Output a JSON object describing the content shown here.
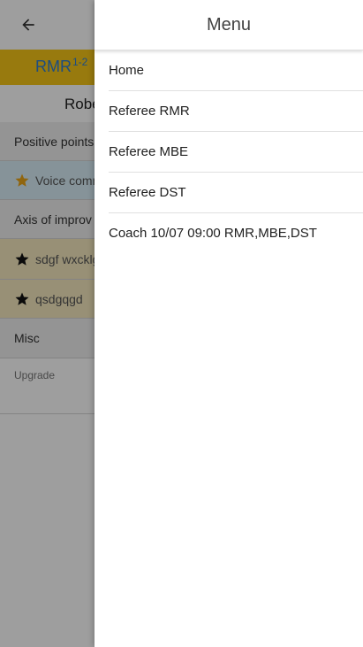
{
  "app": {
    "tab_label": "RMR",
    "tab_superscript": "1-2",
    "person_name": "Robe",
    "rows": [
      {
        "label": "Positive points",
        "kind": "section"
      },
      {
        "label": "Voice comm",
        "kind": "blue"
      },
      {
        "label": "Axis of improv",
        "kind": "section"
      },
      {
        "label": "sdgf wxcklg",
        "kind": "gold"
      },
      {
        "label": "qsdgqgd",
        "kind": "gold"
      },
      {
        "label": "Misc",
        "kind": "section"
      },
      {
        "label": "Upgrade",
        "kind": "small"
      }
    ]
  },
  "drawer": {
    "title": "Menu",
    "items": [
      {
        "label": "Home"
      },
      {
        "label": "Referee RMR"
      },
      {
        "label": "Referee MBE"
      },
      {
        "label": "Referee DST"
      },
      {
        "label": "Coach 10/07 09:00 RMR,MBE,DST"
      }
    ]
  },
  "colors": {
    "tab_background": "#f5c518",
    "accent_blue": "#2f7dd1",
    "star_gold": "#e8a317",
    "star_black": "#111111"
  },
  "icons": {
    "back": "arrow-left-icon",
    "positive_star": "star-icon",
    "improvement_star": "star-icon"
  }
}
